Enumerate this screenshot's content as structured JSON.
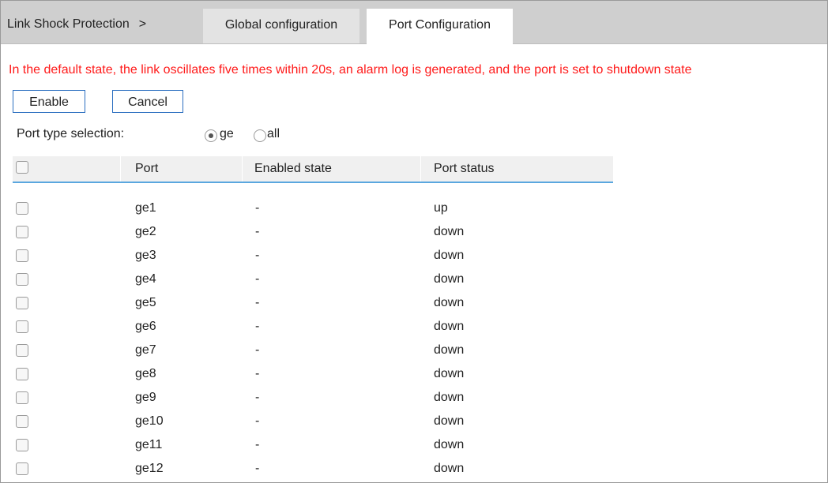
{
  "tabs": {
    "breadcrumb": "Link Shock Protection",
    "breadcrumb_sep": ">",
    "global": "Global configuration",
    "port": "Port Configuration"
  },
  "notice": "In the default state, the link oscillates five times within 20s, an alarm log is generated, and the port is set to shutdown state",
  "buttons": {
    "enable": "Enable",
    "cancel": "Cancel"
  },
  "port_type": {
    "label": "Port type selection:",
    "options": [
      {
        "label": "ge",
        "checked": true
      },
      {
        "label": "all",
        "checked": false
      }
    ]
  },
  "table": {
    "headers": [
      "Port",
      "Enabled state",
      "Port status"
    ],
    "rows": [
      {
        "port": "ge1",
        "enabled": "-",
        "status": "up"
      },
      {
        "port": "ge2",
        "enabled": "-",
        "status": "down"
      },
      {
        "port": "ge3",
        "enabled": "-",
        "status": "down"
      },
      {
        "port": "ge4",
        "enabled": "-",
        "status": "down"
      },
      {
        "port": "ge5",
        "enabled": "-",
        "status": "down"
      },
      {
        "port": "ge6",
        "enabled": "-",
        "status": "down"
      },
      {
        "port": "ge7",
        "enabled": "-",
        "status": "down"
      },
      {
        "port": "ge8",
        "enabled": "-",
        "status": "down"
      },
      {
        "port": "ge9",
        "enabled": "-",
        "status": "down"
      },
      {
        "port": "ge10",
        "enabled": "-",
        "status": "down"
      },
      {
        "port": "ge11",
        "enabled": "-",
        "status": "down"
      },
      {
        "port": "ge12",
        "enabled": "-",
        "status": "down"
      }
    ]
  },
  "colors": {
    "notice": "#ff1a1a",
    "accent": "#2c6fc0",
    "header_line": "#5aa7df",
    "tabbar": "#cfcfcf"
  }
}
